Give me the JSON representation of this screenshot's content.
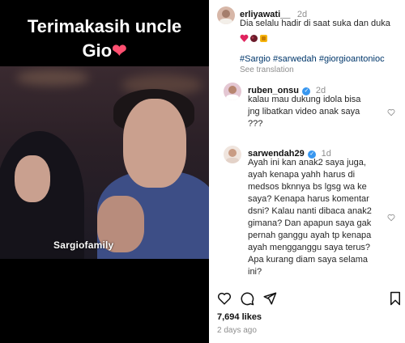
{
  "video": {
    "caption_line1": "Terimakasih uncle",
    "caption_line2": "Gio",
    "heart": "❤",
    "watermark": "Sargiofamily"
  },
  "post": {
    "author": "erliyawati__",
    "time": "2d",
    "text": "Dia selalu hadir di saat suka dan duka",
    "hashtags": "#Sargio #sarwedah #giorgioantonioc",
    "see_translation": "See translation"
  },
  "comments": [
    {
      "username": "ruben_onsu",
      "time": "2d",
      "lines": [
        "kalau mau dukung idola bisa",
        "jng libatkan video anak saya",
        "???"
      ]
    },
    {
      "username": "sarwendah29",
      "time": "1d",
      "lines": [
        "Ayah ini kan anak2 saya juga,",
        "ayah kenapa yahh harus di",
        "medsos bknnya bs lgsg wa ke",
        "saya? Kenapa harus komentar",
        "dsni? Kalau nanti dibaca anak2",
        "gimana? Dan apapun saya gak",
        "pernah ganggu ayah tp kenapa",
        "ayah mengganggu saya terus?",
        "Apa kurang diam saya selama",
        "ini?"
      ]
    }
  ],
  "footer": {
    "likes": "7,694 likes",
    "ago": "2 days ago"
  },
  "icons": [
    "heart-icon",
    "comment-icon",
    "share-icon",
    "bookmark-icon",
    "verified-icon"
  ],
  "colors": {
    "link": "#00376b",
    "verified": "#3897f0",
    "muted": "#8e8e8e",
    "video_bg": "#000000"
  }
}
